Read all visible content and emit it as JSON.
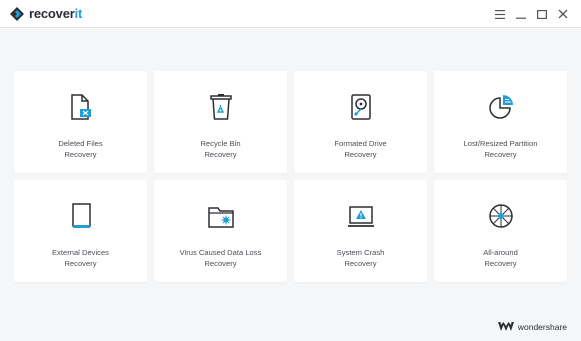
{
  "app": {
    "brand_main": "recover",
    "brand_accent": "it"
  },
  "window_controls": {
    "menu_icon": "hamburger-menu-icon",
    "minimize_icon": "minimize-icon",
    "maximize_icon": "maximize-icon",
    "close_icon": "close-icon"
  },
  "cards": [
    {
      "line1": "Deleted Files",
      "line2": "Recovery",
      "icon": "deleted-file-icon"
    },
    {
      "line1": "Recycle Bin",
      "line2": "Recovery",
      "icon": "recycle-bin-icon"
    },
    {
      "line1": "Formated Drive",
      "line2": "Recovery",
      "icon": "formatted-drive-icon"
    },
    {
      "line1": "Lost/Resized Partition",
      "line2": "Recovery",
      "icon": "partition-pie-icon"
    },
    {
      "line1": "External Devices",
      "line2": "Recovery",
      "icon": "external-device-icon"
    },
    {
      "line1": "Virus Caused Data Loss",
      "line2": "Recovery",
      "icon": "virus-folder-icon"
    },
    {
      "line1": "System Crash",
      "line2": "Recovery",
      "icon": "system-crash-icon"
    },
    {
      "line1": "All-around",
      "line2": "Recovery",
      "icon": "all-around-icon"
    }
  ],
  "footer": {
    "company": "wondershare"
  },
  "colors": {
    "accent": "#1f9ed9",
    "icon_dark": "#2b2f34",
    "background": "#f5f6f8",
    "card": "#ffffff"
  }
}
